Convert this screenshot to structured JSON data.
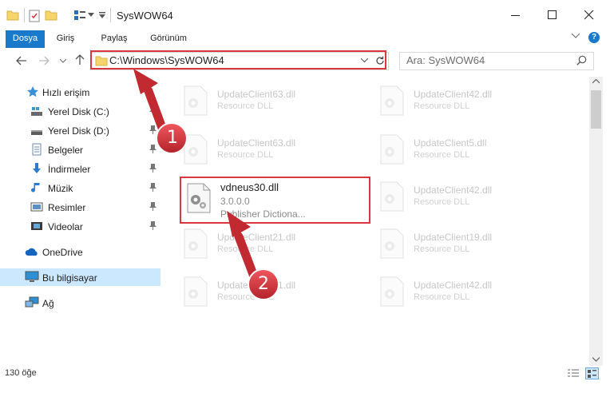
{
  "window": {
    "title": "SysWOW64",
    "controls": [
      "minimize-icon",
      "maximize-icon",
      "close-icon"
    ]
  },
  "ribbon": {
    "tabs": [
      {
        "label": "Dosya",
        "active": true
      },
      {
        "label": "Giriş"
      },
      {
        "label": "Paylaş"
      },
      {
        "label": "Görünüm"
      }
    ],
    "help": "?"
  },
  "navigation": {
    "address": "C:\\Windows\\SysWOW64",
    "search_placeholder": "Ara: SysWOW64"
  },
  "sidebar": {
    "items": [
      {
        "label": "Hızlı erişim",
        "icon": "star-icon"
      },
      {
        "label": "Yerel Disk (C:)",
        "icon": "drive-icon",
        "pinned": true
      },
      {
        "label": "Yerel Disk (D:)",
        "icon": "drive-icon",
        "pinned": true
      },
      {
        "label": "Belgeler",
        "icon": "documents-icon",
        "pinned": true
      },
      {
        "label": "İndirmeler",
        "icon": "download-icon",
        "pinned": true
      },
      {
        "label": "Müzik",
        "icon": "music-icon",
        "pinned": true
      },
      {
        "label": "Resimler",
        "icon": "pictures-icon",
        "pinned": true
      },
      {
        "label": "Videolar",
        "icon": "videos-icon",
        "pinned": true
      },
      {
        "label": "OneDrive",
        "icon": "onedrive-icon"
      },
      {
        "label": "Bu bilgisayar",
        "icon": "computer-icon",
        "selected": true
      },
      {
        "label": "Ağ",
        "icon": "network-icon"
      }
    ]
  },
  "files": {
    "left": [
      {
        "name": "UpdateClient63.dll",
        "desc": "Resource DLL"
      },
      {
        "name": "UpdateClient63.dll",
        "desc": "Resource DLL"
      },
      {
        "name": "vdneus30.dll",
        "version": "3.0.0.0",
        "desc": "Publisher  Dictiona..."
      },
      {
        "name": "UpdateClient21.dll",
        "desc": "Resource DLL"
      },
      {
        "name": "UpdateClient21.dll",
        "desc": "Resource DLL"
      }
    ],
    "right": [
      {
        "name": "UpdateClient42.dll",
        "desc": "Resource DLL"
      },
      {
        "name": "UpdateClient5.dll",
        "desc": "Resource DLL"
      },
      {
        "name": "UpdateClient42.dll",
        "desc": "Resource DLL"
      },
      {
        "name": "UpdateClient19.dll",
        "desc": "Resource DLL"
      },
      {
        "name": "UpdateClient42.dll",
        "desc": "Resource DLL"
      }
    ]
  },
  "status": {
    "item_count": "130 öğe"
  },
  "annotations": {
    "step1": "1",
    "step2": "2",
    "accent_color": "#d9363e"
  }
}
